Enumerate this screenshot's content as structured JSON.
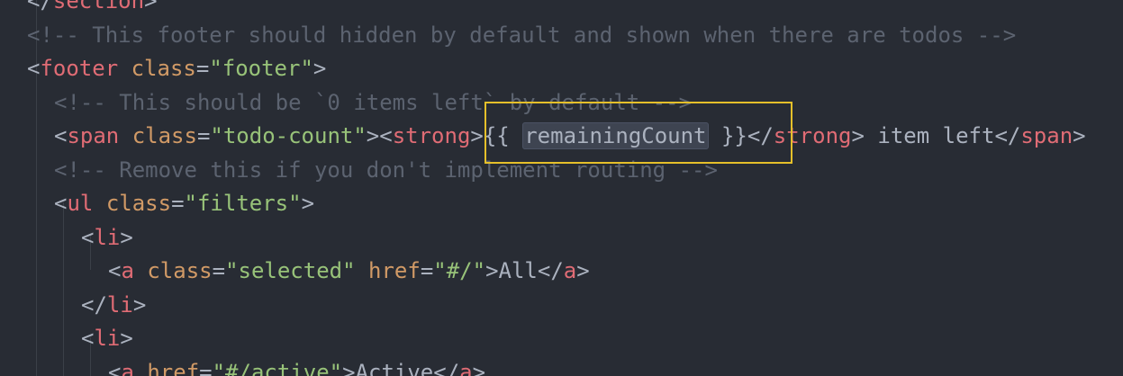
{
  "editor": {
    "colors": {
      "background": "#282c34",
      "punctuation": "#abb2bf",
      "tag": "#e06c75",
      "attribute": "#d19a66",
      "string": "#98c379",
      "comment": "#5c6370",
      "highlight_border": "#e5c02a"
    },
    "highlighted_token": "remainingCount",
    "lines": [
      {
        "tokens": [
          {
            "t": "punct",
            "v": "</"
          },
          {
            "t": "tag",
            "v": "section"
          },
          {
            "t": "punct",
            "v": ">"
          }
        ]
      },
      {
        "tokens": [
          {
            "t": "comment",
            "v": "<!-- This footer should hidden by default and shown when there are todos -->"
          }
        ]
      },
      {
        "tokens": [
          {
            "t": "punct",
            "v": "<"
          },
          {
            "t": "tag",
            "v": "footer"
          },
          {
            "t": "text",
            "v": " "
          },
          {
            "t": "attr",
            "v": "class"
          },
          {
            "t": "punct",
            "v": "="
          },
          {
            "t": "str",
            "v": "\"footer\""
          },
          {
            "t": "punct",
            "v": ">"
          }
        ]
      },
      {
        "tokens": [
          {
            "t": "comment",
            "v": "<!-- This should be `0 items left` by default -->"
          }
        ]
      },
      {
        "tokens": [
          {
            "t": "punct",
            "v": "<"
          },
          {
            "t": "tag",
            "v": "span"
          },
          {
            "t": "text",
            "v": " "
          },
          {
            "t": "attr",
            "v": "class"
          },
          {
            "t": "punct",
            "v": "="
          },
          {
            "t": "str",
            "v": "\"todo-count\""
          },
          {
            "t": "punct",
            "v": "><"
          },
          {
            "t": "tag",
            "v": "strong"
          },
          {
            "t": "punct",
            "v": ">"
          },
          {
            "t": "text",
            "v": "{{ "
          },
          {
            "t": "var",
            "v": "remainingCount"
          },
          {
            "t": "text",
            "v": " }}"
          },
          {
            "t": "punct",
            "v": "</"
          },
          {
            "t": "tag",
            "v": "strong"
          },
          {
            "t": "punct",
            "v": ">"
          },
          {
            "t": "text",
            "v": " item left"
          },
          {
            "t": "punct",
            "v": "</"
          },
          {
            "t": "tag",
            "v": "span"
          },
          {
            "t": "punct",
            "v": ">"
          }
        ]
      },
      {
        "tokens": [
          {
            "t": "comment",
            "v": "<!-- Remove this if you don't implement routing -->"
          }
        ]
      },
      {
        "tokens": [
          {
            "t": "punct",
            "v": "<"
          },
          {
            "t": "tag",
            "v": "ul"
          },
          {
            "t": "text",
            "v": " "
          },
          {
            "t": "attr",
            "v": "class"
          },
          {
            "t": "punct",
            "v": "="
          },
          {
            "t": "str",
            "v": "\"filters\""
          },
          {
            "t": "punct",
            "v": ">"
          }
        ]
      },
      {
        "tokens": [
          {
            "t": "punct",
            "v": "<"
          },
          {
            "t": "tag",
            "v": "li"
          },
          {
            "t": "punct",
            "v": ">"
          }
        ]
      },
      {
        "tokens": [
          {
            "t": "punct",
            "v": "<"
          },
          {
            "t": "tag",
            "v": "a"
          },
          {
            "t": "text",
            "v": " "
          },
          {
            "t": "attr",
            "v": "class"
          },
          {
            "t": "punct",
            "v": "="
          },
          {
            "t": "str",
            "v": "\"selected\""
          },
          {
            "t": "text",
            "v": " "
          },
          {
            "t": "attr",
            "v": "href"
          },
          {
            "t": "punct",
            "v": "="
          },
          {
            "t": "str",
            "v": "\"#/\""
          },
          {
            "t": "punct",
            "v": ">"
          },
          {
            "t": "text",
            "v": "All"
          },
          {
            "t": "punct",
            "v": "</"
          },
          {
            "t": "tag",
            "v": "a"
          },
          {
            "t": "punct",
            "v": ">"
          }
        ]
      },
      {
        "tokens": [
          {
            "t": "punct",
            "v": "</"
          },
          {
            "t": "tag",
            "v": "li"
          },
          {
            "t": "punct",
            "v": ">"
          }
        ]
      },
      {
        "tokens": [
          {
            "t": "punct",
            "v": "<"
          },
          {
            "t": "tag",
            "v": "li"
          },
          {
            "t": "punct",
            "v": ">"
          }
        ]
      },
      {
        "tokens": [
          {
            "t": "punct",
            "v": "<"
          },
          {
            "t": "tag",
            "v": "a"
          },
          {
            "t": "text",
            "v": " "
          },
          {
            "t": "attr",
            "v": "href"
          },
          {
            "t": "punct",
            "v": "="
          },
          {
            "t": "str",
            "v": "\"#/active\""
          },
          {
            "t": "punct",
            "v": ">"
          },
          {
            "t": "text",
            "v": "Active"
          },
          {
            "t": "punct",
            "v": "</"
          },
          {
            "t": "tag",
            "v": "a"
          },
          {
            "t": "punct",
            "v": ">"
          }
        ]
      }
    ]
  }
}
